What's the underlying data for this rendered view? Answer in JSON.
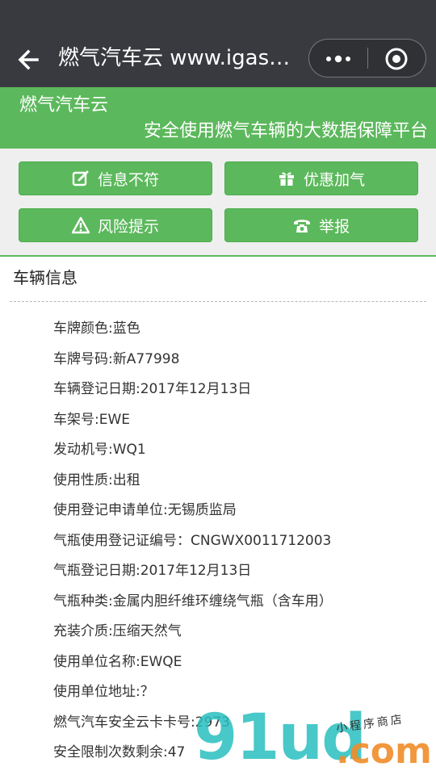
{
  "nav": {
    "title": "燃气汽车云 www.igas…",
    "more_icon": "more-dots-icon",
    "close_icon": "target-circle-icon",
    "back_icon": "arrow-left-icon"
  },
  "hero": {
    "brand": "燃气汽车云",
    "slogan": "安全使用燃气车辆的大数据保障平台"
  },
  "actions": [
    {
      "label": "信息不符",
      "icon": "edit-icon"
    },
    {
      "label": "优惠加气",
      "icon": "gift-icon"
    },
    {
      "label": "风险提示",
      "icon": "warning-icon"
    },
    {
      "label": "举报",
      "icon": "phone-icon"
    }
  ],
  "vehicle": {
    "section_title": "车辆信息",
    "items": [
      "车牌颜色:蓝色",
      "车牌号码:新A77998",
      "车辆登记日期:2017年12月13日",
      "车架号:EWE",
      "发动机号:WQ1",
      "使用性质:出租",
      "使用登记申请单位:无锡质监局",
      "气瓶使用登记证编号：CNGWX0011712003",
      "气瓶登记日期:2017年12月13日",
      "气瓶种类:金属内胆纤维环缠绕气瓶（含车用）",
      "充装介质:压缩天然气",
      "使用单位名称:EWQE",
      "使用单位地址:？",
      "燃气汽车安全云卡卡号:2973",
      "安全限制次数剩余:47"
    ]
  },
  "watermark": {
    "big": "91ud",
    "com": ".com",
    "small": "小程序商店"
  },
  "colors": {
    "nav_bg": "#393a3f",
    "brand_green": "#5cb85c"
  }
}
